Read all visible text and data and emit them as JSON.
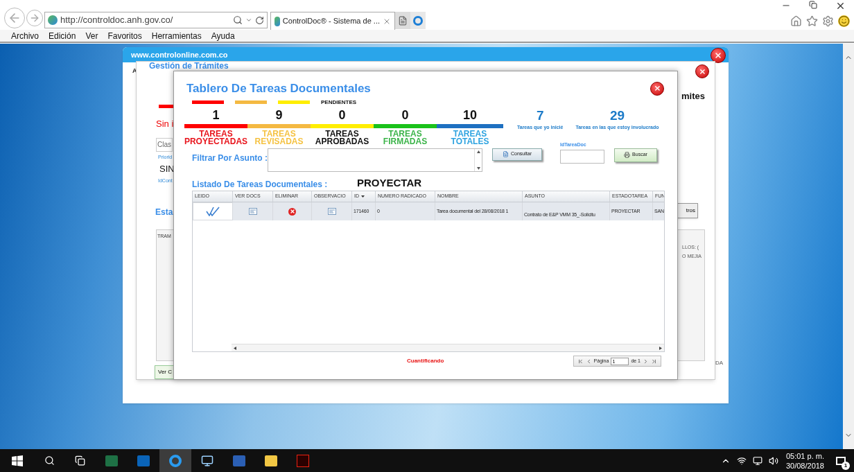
{
  "browser": {
    "address": "http://controldoc.anh.gov.co/",
    "tab_title": "ControlDoc® - Sistema de ...",
    "menu": [
      "Archivo",
      "Edición",
      "Ver",
      "Favoritos",
      "Herramientas",
      "Ayuda"
    ]
  },
  "outer_window": {
    "url": "www.controlonline.com.co",
    "left_letter": "A",
    "right_text": "DA"
  },
  "background_window": {
    "title": "Gestión de Trámites",
    "heading_end": "mites",
    "fragments": [
      {
        "kind": "red",
        "text": "Sin i"
      },
      {
        "kind": "input",
        "text": "Clas"
      },
      {
        "kind": "tiny",
        "text": "Priorid"
      },
      {
        "kind": "value",
        "text": "SIN"
      },
      {
        "kind": "tiny",
        "text": "IdCont"
      },
      {
        "kind": "section",
        "text": "Esta"
      }
    ],
    "table_header": "TRAM",
    "right_lines": [
      "LLOS: (",
      "O MEJIA"
    ],
    "side_button": "tros",
    "bottom_button": "Ver C"
  },
  "dialog": {
    "title": "Tablero De Tareas Documentales",
    "pending_label": "PENDIENTES",
    "pending_marks": [
      {
        "color": "#ff0000"
      },
      {
        "color": "#f4b942"
      },
      {
        "color": "#ffee00"
      }
    ],
    "counters": [
      {
        "value": "1",
        "color": "#ff0000",
        "label": {
          "color": "#e8141c",
          "lines": [
            "TAREAS",
            "PROYECTADAS"
          ]
        }
      },
      {
        "value": "9",
        "color": "#f4b942",
        "label": {
          "color": "#f5c242",
          "lines": [
            "TAREAS",
            "REVISADAS"
          ]
        }
      },
      {
        "value": "0",
        "color": "#ffee00",
        "label": {
          "color": "#111111",
          "lines": [
            "TAREAS",
            "APROBADAS"
          ]
        }
      },
      {
        "value": "0",
        "color": "#1bc21b",
        "label": {
          "color": "#3cb44a",
          "lines": [
            "TAREAS",
            "FIRMADAS"
          ]
        }
      },
      {
        "value": "10",
        "color": "#1e70c1",
        "label": {
          "color": "#2ea3e0",
          "lines": [
            "TAREAS",
            "TOTALES"
          ]
        }
      }
    ],
    "extra_stats": [
      {
        "value": "7",
        "caption": "Tareas que yo inicié"
      },
      {
        "value": "29",
        "caption": "Tareas en las que estoy involucrado"
      }
    ],
    "filter_label": "Filtrar Por Asunto :",
    "consult_button": "Consultar",
    "id_label": "IdTareaDoc",
    "search_button": "Buscar",
    "list_title": "Listado De Tareas Documentales :",
    "list_state": "PROYECTAR",
    "table": {
      "columns": [
        "LEIDO",
        "VER DOCS",
        "ELIMINAR",
        "OBSERVACIO",
        "ID",
        "NUMERO RADICADO",
        "NOMBRE",
        "ASUNTO",
        "ESTADOTAREA",
        "FUN"
      ],
      "rows": [
        {
          "cells": [
            {
              "kind": "read"
            },
            {
              "kind": "docs"
            },
            {
              "kind": "delete"
            },
            {
              "kind": "docs"
            },
            {
              "kind": "text",
              "text": "171460"
            },
            {
              "kind": "text",
              "text": "0"
            },
            {
              "kind": "text",
              "text": "Tarea documental del 28/08/2018 1"
            },
            {
              "kind": "low",
              "text": "Contrato de E&P VMM 35_-Solicitu"
            },
            {
              "kind": "text",
              "text": "PROYECTAR"
            },
            {
              "kind": "text",
              "text": "SAN"
            }
          ]
        }
      ]
    },
    "status_text": "Cuantificando",
    "pager": {
      "label": "Página",
      "page": "1",
      "of": "de 1"
    }
  },
  "taskbar": {
    "time": "05:01 p. m.",
    "date": "30/08/2018",
    "notifications": "1"
  }
}
